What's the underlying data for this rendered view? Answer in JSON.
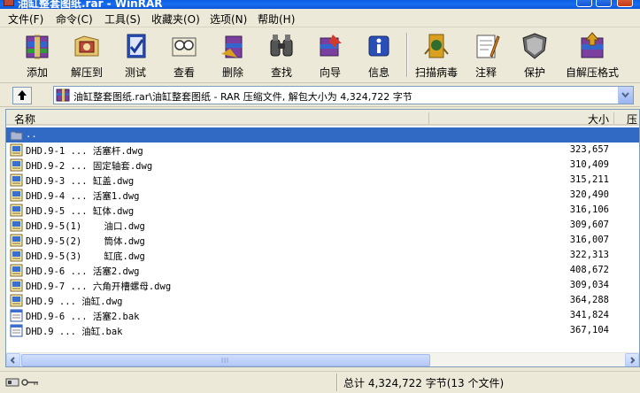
{
  "window": {
    "title": "油缸整套图纸.rar - WinRAR"
  },
  "menu": [
    "文件(F)",
    "命令(C)",
    "工具(S)",
    "收藏夹(O)",
    "选项(N)",
    "帮助(H)"
  ],
  "toolbar": [
    {
      "label": "添加",
      "icon": "add-archive-icon"
    },
    {
      "label": "解压到",
      "icon": "extract-to-icon"
    },
    {
      "label": "测试",
      "icon": "test-icon"
    },
    {
      "label": "查看",
      "icon": "view-icon"
    },
    {
      "label": "删除",
      "icon": "delete-icon"
    },
    {
      "label": "查找",
      "icon": "find-icon"
    },
    {
      "label": "向导",
      "icon": "wizard-icon"
    },
    {
      "label": "信息",
      "icon": "info-icon"
    },
    {
      "label": "扫描病毒",
      "icon": "virus-scan-icon"
    },
    {
      "label": "注释",
      "icon": "comment-icon"
    },
    {
      "label": "保护",
      "icon": "protect-icon"
    },
    {
      "label": "自解压格式",
      "icon": "sfx-icon"
    }
  ],
  "address": {
    "path": "油缸整套图纸.rar\\油缸整套图纸 - RAR 压缩文件, 解包大小为 4,324,722 字节"
  },
  "columns": {
    "name": "名称",
    "size": "大小",
    "packed": "压"
  },
  "files": [
    {
      "name": "..",
      "size": "",
      "type": "folder",
      "selected": true
    },
    {
      "name": "DHD.9-1 ... 活塞杆.dwg",
      "size": "323,657",
      "type": "dwg"
    },
    {
      "name": "DHD.9-2 ... 固定轴套.dwg",
      "size": "310,409",
      "type": "dwg"
    },
    {
      "name": "DHD.9-3 ... 缸盖.dwg",
      "size": "315,211",
      "type": "dwg"
    },
    {
      "name": "DHD.9-4 ... 活塞1.dwg",
      "size": "320,490",
      "type": "dwg"
    },
    {
      "name": "DHD.9-5 ... 缸体.dwg",
      "size": "316,106",
      "type": "dwg"
    },
    {
      "name": "DHD.9-5(1)    油口.dwg",
      "size": "309,607",
      "type": "dwg"
    },
    {
      "name": "DHD.9-5(2)    筒体.dwg",
      "size": "316,007",
      "type": "dwg"
    },
    {
      "name": "DHD.9-5(3)    缸底.dwg",
      "size": "322,313",
      "type": "dwg"
    },
    {
      "name": "DHD.9-6 ... 活塞2.dwg",
      "size": "408,672",
      "type": "dwg"
    },
    {
      "name": "DHD.9-7 ... 六角开槽螺母.dwg",
      "size": "309,034",
      "type": "dwg"
    },
    {
      "name": "DHD.9 ... 油缸.dwg",
      "size": "364,288",
      "type": "dwg"
    },
    {
      "name": "DHD.9-6 ... 活塞2.bak",
      "size": "341,824",
      "type": "bak"
    },
    {
      "name": "DHD.9 ... 油缸.bak",
      "size": "367,104",
      "type": "bak"
    }
  ],
  "status": {
    "summary": "总计 4,324,722 字节(13 个文件)"
  },
  "colors": {
    "selection": "#316ac5",
    "titlebar": "#0a5fe4",
    "background": "#ece9d8"
  }
}
